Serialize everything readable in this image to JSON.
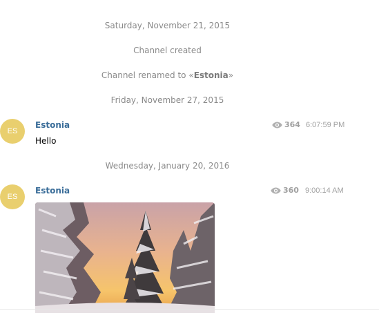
{
  "service_messages": {
    "date1": "Saturday, November 21, 2015",
    "created": "Channel created",
    "renamed_prefix": "Channel renamed to «",
    "renamed_name": "Estonia",
    "renamed_suffix": "»",
    "date2": "Friday, November 27, 2015",
    "date3": "Wednesday, January 20, 2016"
  },
  "messages": [
    {
      "avatar_initials": "ES",
      "author": "Estonia",
      "views": "364",
      "time": "6:07:59 PM",
      "text": "Hello"
    },
    {
      "avatar_initials": "ES",
      "author": "Estonia",
      "views": "360",
      "time": "9:00:14 AM",
      "media": "photo"
    }
  ],
  "icons": {
    "views": "eye-icon"
  },
  "colors": {
    "avatar": "#e9cf6e",
    "author": "#3a6d99",
    "meta": "#a0a0a0"
  }
}
